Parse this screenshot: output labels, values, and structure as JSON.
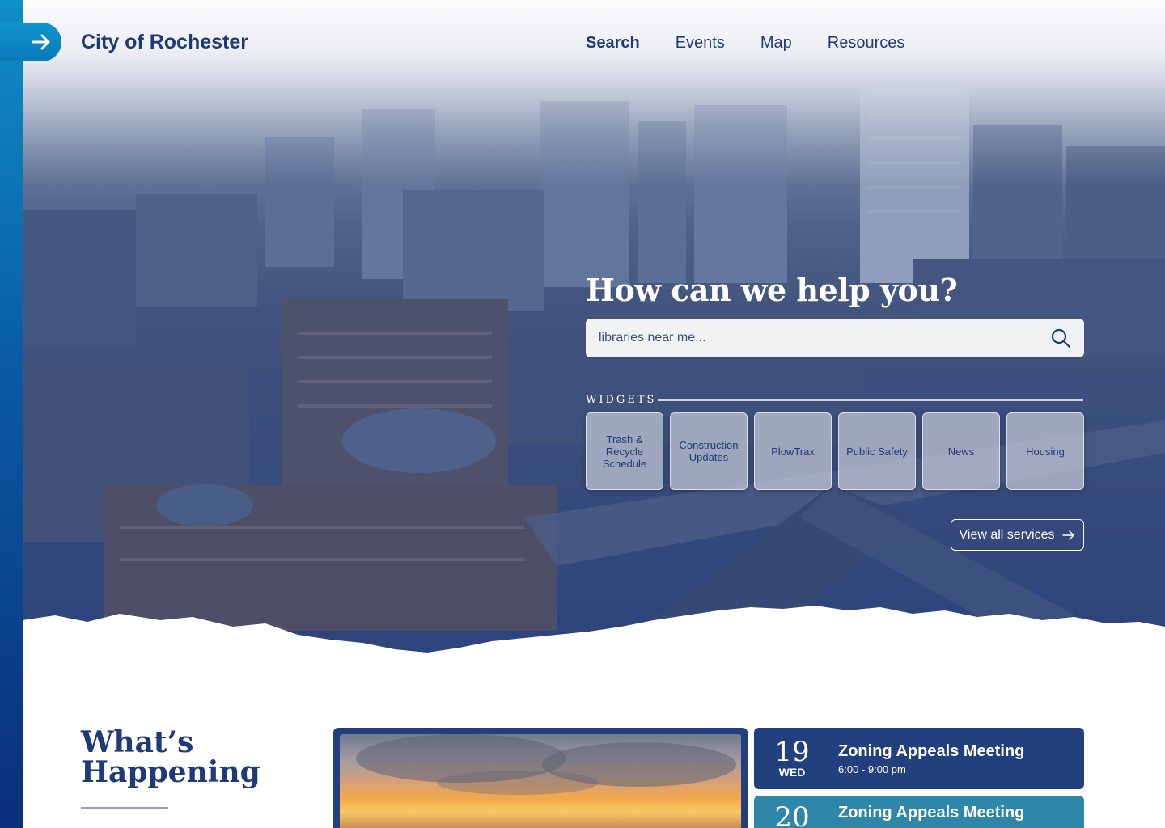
{
  "brand": {
    "name": "City of Rochester"
  },
  "nav": {
    "items": [
      {
        "label": "Search",
        "active": true
      },
      {
        "label": "Events",
        "active": false
      },
      {
        "label": "Map",
        "active": false
      },
      {
        "label": "Resources",
        "active": false
      }
    ]
  },
  "hero": {
    "title": "How can we help you?",
    "search_placeholder": "libraries near me...",
    "widgets_label": "WIDGETS",
    "widgets": [
      {
        "label": "Trash & Recycle Schedule",
        "icon": "trash-icon"
      },
      {
        "label": "Construction Updates",
        "icon": "construction-icon"
      },
      {
        "label": "PlowTrax",
        "icon": "plow-icon"
      },
      {
        "label": "Public Safety",
        "icon": "shield-icon"
      },
      {
        "label": "News",
        "icon": "news-icon"
      },
      {
        "label": "Housing",
        "icon": "house-icon"
      }
    ],
    "view_all": "View all services"
  },
  "happening": {
    "title_line1": "What’s",
    "title_line2": "Happening",
    "events": [
      {
        "day": "19",
        "dow": "WED",
        "name": "Zoning Appeals Meeting",
        "time": "6:00 - 9:00 pm"
      },
      {
        "day": "20",
        "dow": "",
        "name": "Zoning Appeals Meeting",
        "time": ""
      }
    ]
  },
  "colors": {
    "brand_navy": "#1f3a78",
    "rail_top": "#0e8fc6",
    "rail_bottom": "#0a2f7a",
    "event_primary": "#22407e",
    "event_secondary": "#2e86a8"
  }
}
